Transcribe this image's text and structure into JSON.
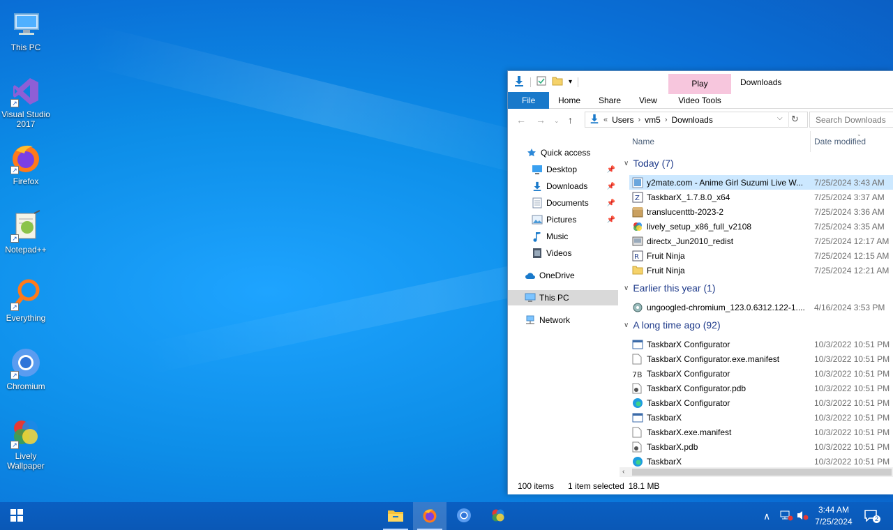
{
  "desktop": {
    "icons": [
      {
        "label": "This PC"
      },
      {
        "label": "Visual Studio 2017"
      },
      {
        "label": "Firefox"
      },
      {
        "label": "Notepad++"
      },
      {
        "label": "Everything"
      },
      {
        "label": "Chromium"
      },
      {
        "label": "Lively Wallpaper"
      }
    ]
  },
  "explorer": {
    "title": "Downloads",
    "contextual_tab": "Play",
    "contextual_group": "Video Tools",
    "tabs": [
      "File",
      "Home",
      "Share",
      "View"
    ],
    "address": {
      "prefix": "«",
      "crumbs": [
        "Users",
        "vm5",
        "Downloads"
      ]
    },
    "search_placeholder": "Search Downloads",
    "nav": {
      "quick_access": "Quick access",
      "items": [
        "Desktop",
        "Downloads",
        "Documents",
        "Pictures",
        "Music",
        "Videos"
      ],
      "onedrive": "OneDrive",
      "this_pc": "This PC",
      "network": "Network"
    },
    "columns": {
      "name": "Name",
      "date": "Date modified"
    },
    "groups": [
      {
        "label": "Today (7)"
      },
      {
        "label": "Earlier this year (1)"
      },
      {
        "label": "A long time ago (92)"
      }
    ],
    "files_today": [
      {
        "name": "y2mate.com - Anime Girl Suzumi Live W...",
        "date": "7/25/2024 3:43 AM"
      },
      {
        "name": "TaskbarX_1.7.8.0_x64",
        "date": "7/25/2024 3:37 AM"
      },
      {
        "name": "translucenttb-2023-2",
        "date": "7/25/2024 3:36 AM"
      },
      {
        "name": "lively_setup_x86_full_v2108",
        "date": "7/25/2024 3:35 AM"
      },
      {
        "name": "directx_Jun2010_redist",
        "date": "7/25/2024 12:17 AM"
      },
      {
        "name": "Fruit Ninja",
        "date": "7/25/2024 12:15 AM"
      },
      {
        "name": "Fruit Ninja",
        "date": "7/25/2024 12:21 AM"
      }
    ],
    "files_earlier": [
      {
        "name": "ungoogled-chromium_123.0.6312.122-1....",
        "date": "4/16/2024 3:53 PM"
      }
    ],
    "files_old": [
      {
        "name": "TaskbarX Configurator",
        "date": "10/3/2022 10:51 PM"
      },
      {
        "name": "TaskbarX Configurator.exe.manifest",
        "date": "10/3/2022 10:51 PM"
      },
      {
        "name": "TaskbarX Configurator",
        "date": "10/3/2022 10:51 PM"
      },
      {
        "name": "TaskbarX Configurator.pdb",
        "date": "10/3/2022 10:51 PM"
      },
      {
        "name": "TaskbarX Configurator",
        "date": "10/3/2022 10:51 PM"
      },
      {
        "name": "TaskbarX",
        "date": "10/3/2022 10:51 PM"
      },
      {
        "name": "TaskbarX.exe.manifest",
        "date": "10/3/2022 10:51 PM"
      },
      {
        "name": "TaskbarX.pdb",
        "date": "10/3/2022 10:51 PM"
      },
      {
        "name": "TaskbarX",
        "date": "10/3/2022 10:51 PM"
      }
    ],
    "status": {
      "items": "100 items",
      "selected": "1 item selected",
      "size": "18.1 MB"
    }
  },
  "taskbar": {
    "clock_time": "3:44 AM",
    "clock_date": "7/25/2024",
    "notification_count": "2"
  },
  "colors": {
    "accent": "#1979ca",
    "selection": "#cce8ff",
    "play_tab": "#f7c6dd"
  }
}
